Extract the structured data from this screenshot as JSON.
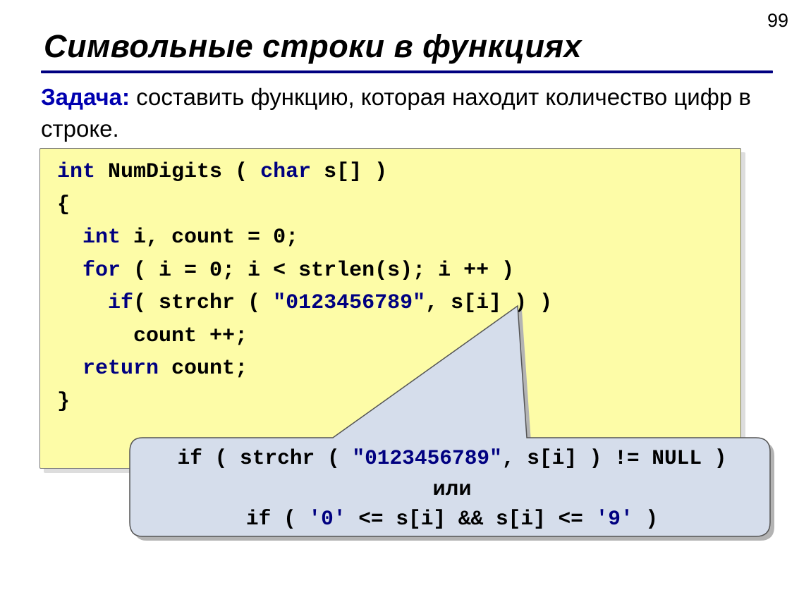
{
  "page_number": "99",
  "heading": "Символьные строки в функциях",
  "task_label": "Задача:",
  "task_text": " составить функцию, которая находит количество цифр в строке.",
  "code": {
    "l1a": "int",
    "l1b": " NumDigits ( ",
    "l1c": "char",
    "l1d": " s[] )",
    "l2": "{",
    "l3a": "int",
    "l3b": " i, count = 0;",
    "l4a": "for",
    "l4b": " ( i = 0; i < strlen(s); i ++ )",
    "l5a": "if",
    "l5b": "( strchr ( ",
    "l5c": "\"0123456789\"",
    "l5d": ", s[i] ) )",
    "l6": "count ++;",
    "l7a": "return",
    "l7b": " count;",
    "l8": "}"
  },
  "callout": {
    "line1a": "if ( strchr ( ",
    "line1b": "\"0123456789\"",
    "line1c": ", s[i] ) != NULL )",
    "line2": "или",
    "line3a": "if ( ",
    "line3b": "'0'",
    "line3c": " <= s[i] && s[i] <= ",
    "line3d": "'9'",
    "line3e": " )"
  }
}
